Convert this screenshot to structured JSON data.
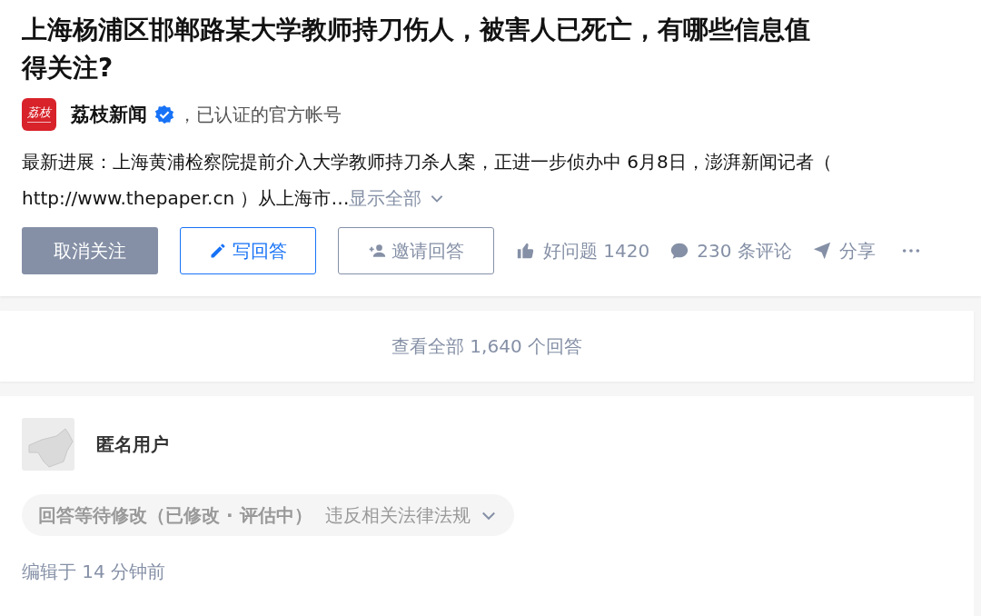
{
  "question": {
    "title": "上海杨浦区邯郸路某大学教师持刀伤人，被害人已死亡，有哪些信息值得关注?",
    "author": {
      "logo_text": "荔枝",
      "name": "荔枝新闻",
      "verified": true,
      "note": "，已认证的官方帐号"
    },
    "description_lines": [
      "最新进展：上海黄浦检察院提前介入大学教师持刀杀人案，正进一步侦办中 6月8日，澎湃新闻记者（",
      "http://www.thepaper.cn ）从上海市…"
    ],
    "expand_link": "显示全部",
    "actions": [
      {
        "kind": "filled",
        "label": "取消关注"
      },
      {
        "kind": "write",
        "label": "写回答"
      },
      {
        "kind": "invite",
        "label": "邀请回答"
      },
      {
        "kind": "like",
        "label": "好问题 1420"
      },
      {
        "kind": "comment",
        "label": "230 条评论"
      },
      {
        "kind": "share",
        "label": "分享"
      },
      {
        "kind": "more"
      }
    ]
  },
  "view_all": "查看全部 1,640 个回答",
  "answer": {
    "user": "匿名用户",
    "status": "回答等待修改（已修改 · 评估中）",
    "reason": "违反相关法律法规",
    "edited": "编辑于 14 分钟前"
  }
}
